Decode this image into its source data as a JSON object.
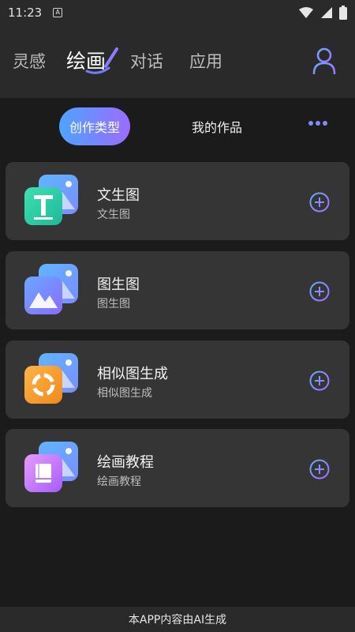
{
  "status_bar": {
    "time": "11:23",
    "notification_glyph": "A"
  },
  "nav": {
    "tabs": [
      {
        "label": "灵感"
      },
      {
        "label": "绘画"
      },
      {
        "label": "对话"
      },
      {
        "label": "应用"
      }
    ],
    "active_index": 1
  },
  "sub_tabs": {
    "active": "创作类型",
    "other": "我的作品"
  },
  "cards": [
    {
      "title": "文生图",
      "subtitle": "文生图",
      "icon": "text-to-image-icon"
    },
    {
      "title": "图生图",
      "subtitle": "图生图",
      "icon": "image-to-image-icon"
    },
    {
      "title": "相似图生成",
      "subtitle": "相似图生成",
      "icon": "similar-image-icon"
    },
    {
      "title": "绘画教程",
      "subtitle": "绘画教程",
      "icon": "tutorial-book-icon"
    }
  ],
  "footer": {
    "text": "本APP内容由AI生成"
  },
  "colors": {
    "accent_start": "#4ea3ff",
    "accent_end": "#9b6cff",
    "card_bg": "#353535",
    "page_bg": "#1b1b1b"
  }
}
